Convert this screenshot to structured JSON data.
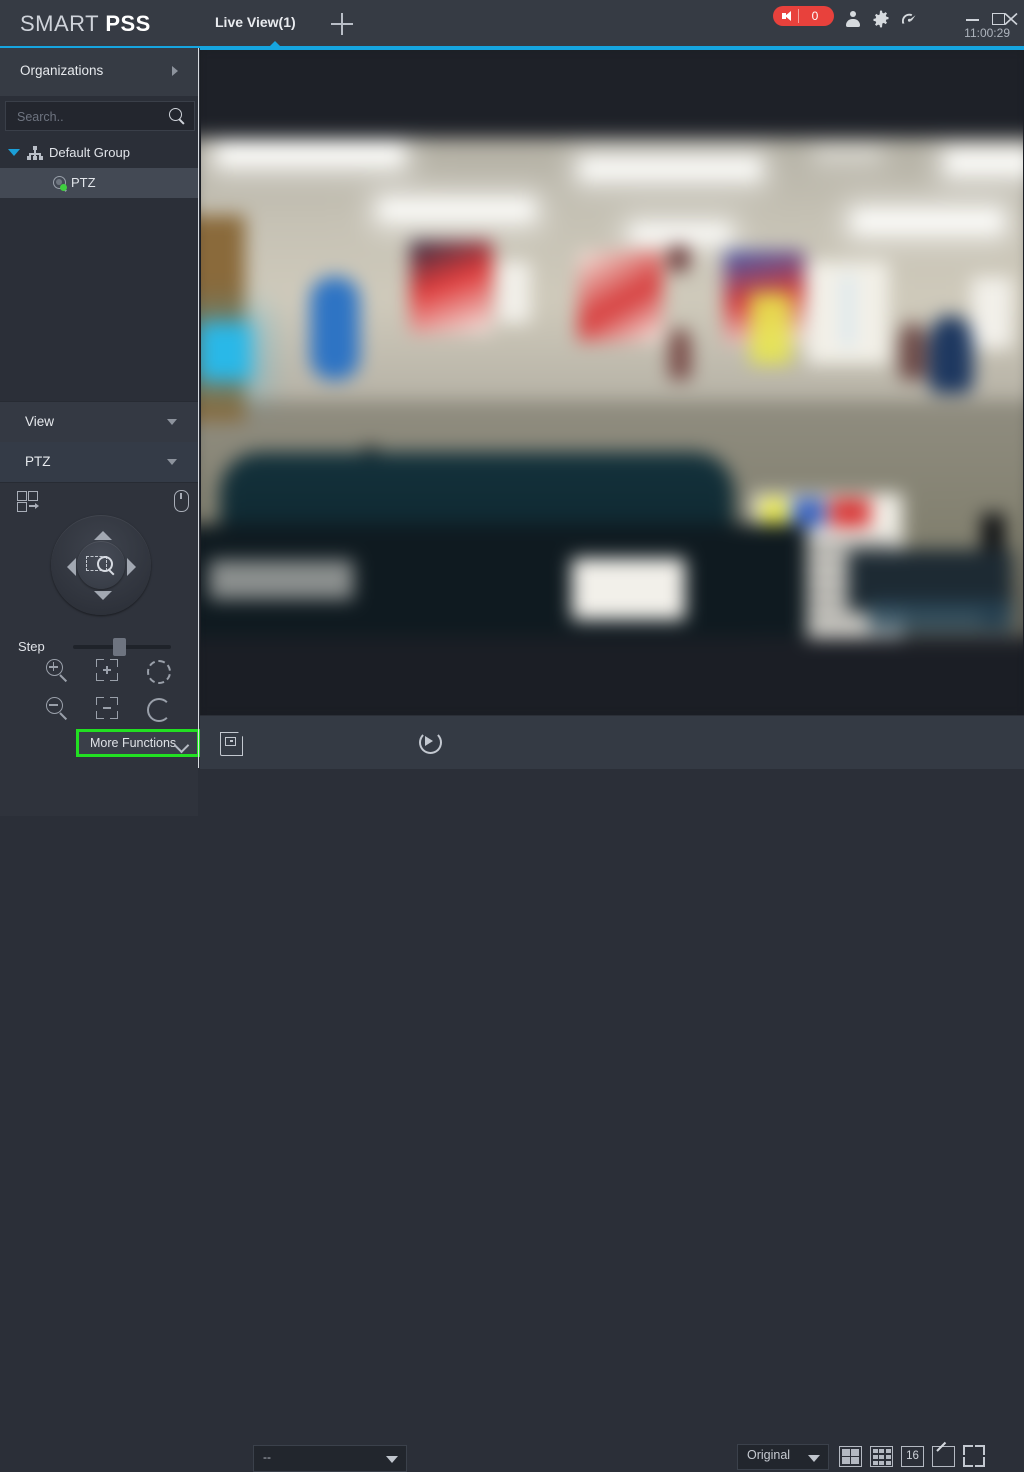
{
  "app": {
    "brand_smart": "SMART ",
    "brand_pss": "PSS",
    "clock": "11:00:29"
  },
  "titlebar": {
    "tabs": [
      {
        "label": "Live View(1)",
        "active": true
      }
    ],
    "add_tab_label": "+",
    "alarm": {
      "icon": "speaker-icon",
      "count": "0",
      "color": "#e8413c"
    },
    "icons": [
      {
        "name": "user-icon"
      },
      {
        "name": "gear-icon"
      },
      {
        "name": "gauge-icon"
      }
    ],
    "window_controls": [
      {
        "name": "minimize-button",
        "glyph": "—"
      },
      {
        "name": "maximize-button",
        "glyph": "□"
      },
      {
        "name": "close-button",
        "glyph": "✕"
      }
    ]
  },
  "sidebar": {
    "organizations": {
      "label": "Organizations",
      "expand_icon": "chevron-right-icon"
    },
    "search": {
      "value": "",
      "placeholder": "Search..",
      "icon": "search-icon"
    },
    "tree": [
      {
        "label": "Default Group",
        "icon": "group-icon",
        "level": 0,
        "expanded": true,
        "selected": false
      },
      {
        "label": "PTZ",
        "icon": "camera-icon",
        "level": 1,
        "selected": true,
        "status": "online"
      }
    ],
    "panels": [
      {
        "label": "View",
        "collapsed": true,
        "icon": "chevron-down-icon"
      },
      {
        "label": "PTZ",
        "collapsed": false,
        "icon": "chevron-down-icon"
      }
    ]
  },
  "ptz": {
    "preset_icon": "preset-tour-icon",
    "mouse_icon": "mouse-control-icon",
    "dpad": {
      "up": "pan-up-button",
      "down": "pan-down-button",
      "left": "pan-left-button",
      "right": "pan-right-button",
      "center": "area-zoom-button"
    },
    "step": {
      "label": "Step",
      "value": 5,
      "min": 1,
      "max": 8
    },
    "buttons": [
      {
        "name": "zoom-in-button",
        "row": 1,
        "col": 1
      },
      {
        "name": "focus-near-button",
        "row": 1,
        "col": 2
      },
      {
        "name": "iris-open-button",
        "row": 1,
        "col": 3
      },
      {
        "name": "zoom-out-button",
        "row": 2,
        "col": 1
      },
      {
        "name": "focus-far-button",
        "row": 2,
        "col": 2
      },
      {
        "name": "iris-close-button",
        "row": 2,
        "col": 3
      }
    ],
    "more_functions": {
      "label": "More Functions",
      "icon": "chevron-down-icon",
      "highlight": "#22e022"
    }
  },
  "toolbar": {
    "save_icon": "save-snapshot-icon",
    "stream_select": {
      "value": "--",
      "icon": "chevron-down-icon"
    },
    "refresh_icon": "refresh-playback-icon",
    "ratio_select": {
      "value": "Original",
      "icon": "chevron-down-icon"
    },
    "layout_buttons": [
      {
        "name": "split-4-button",
        "label": ""
      },
      {
        "name": "split-9-button",
        "label": ""
      },
      {
        "name": "split-16-button",
        "label": "16"
      },
      {
        "name": "annotate-button",
        "label": ""
      }
    ],
    "fullscreen_button": {
      "name": "fullscreen-button"
    }
  },
  "video": {
    "title": "Live video preview",
    "description": "Blurred indoor office/retail interior with ceiling light fixtures, wall posters and a reception counter",
    "accent_color": "#16a5e0"
  }
}
